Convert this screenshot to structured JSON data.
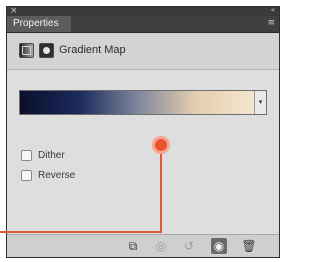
{
  "window": {
    "close_glyph": "×",
    "collapse_glyph": "«"
  },
  "tabs": [
    {
      "label": "Properties"
    }
  ],
  "panel_menu_glyph": "≡",
  "adjustment": {
    "title": "Gradient Map",
    "icons": [
      "gradient-map-icon",
      "layer-mask-icon"
    ]
  },
  "gradient": {
    "stops": [
      "#0b0f2a",
      "#1a2a5c",
      "#7d869b",
      "#e6cfb0",
      "#f4e4cf"
    ],
    "dropdown_glyph": "▾"
  },
  "options": {
    "dither_label": "Dither",
    "reverse_label": "Reverse"
  },
  "bottom_toolbar": {
    "icons": [
      {
        "name": "clip-to-layer-icon",
        "glyph": "⧉"
      },
      {
        "name": "view-previous-state-icon",
        "glyph": "◎"
      },
      {
        "name": "reset-icon",
        "glyph": "↺"
      },
      {
        "name": "toggle-visibility-icon",
        "glyph": "◉"
      },
      {
        "name": "delete-icon",
        "glyph": "🗑"
      }
    ]
  },
  "colors": {
    "callout": "#e0573a",
    "panel_bg": "#dedede",
    "frame": "#4c4c4c"
  }
}
